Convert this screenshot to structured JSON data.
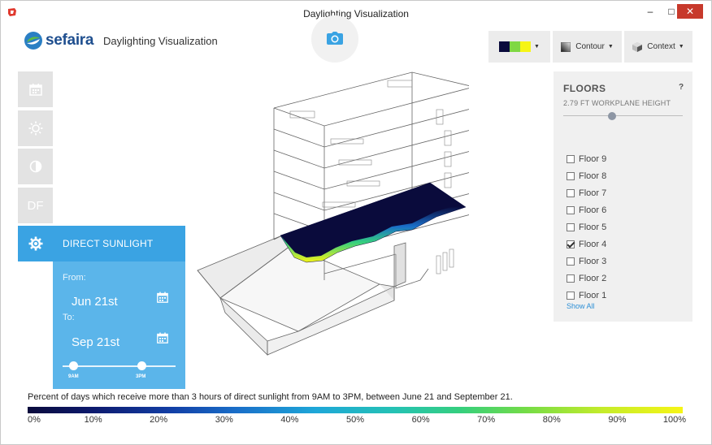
{
  "window": {
    "title": "Daylighting Visualization",
    "minimize": "‒",
    "maximize": "□",
    "close": "✕"
  },
  "header": {
    "brand": "sefaira",
    "title": "Daylighting Visualization"
  },
  "toolbar": {
    "colors": [
      "#0a0b3c",
      "#7fd843",
      "#f6f516"
    ],
    "contour_label": "Contour",
    "context_label": "Context"
  },
  "sidebar": {
    "items": [
      {
        "name": "calendar-icon"
      },
      {
        "name": "sun-icon"
      },
      {
        "name": "contrast-icon"
      },
      {
        "name": "df",
        "label": "DF"
      },
      {
        "name": "gear-icon",
        "active": true
      }
    ]
  },
  "sunlight_panel": {
    "title": "DIRECT SUNLIGHT",
    "from_label": "From:",
    "from_date": "Jun 21st",
    "to_label": "To:",
    "to_date": "Sep 21st",
    "time_start": "9AM",
    "time_end": "3PM"
  },
  "floors_panel": {
    "title": "FLOORS",
    "help": "?",
    "subtitle": "2.79 FT WORKPLANE HEIGHT",
    "floors": [
      {
        "label": "Floor 9",
        "checked": false
      },
      {
        "label": "Floor 8",
        "checked": false
      },
      {
        "label": "Floor 7",
        "checked": false
      },
      {
        "label": "Floor 6",
        "checked": false
      },
      {
        "label": "Floor 5",
        "checked": false
      },
      {
        "label": "Floor 4",
        "checked": true
      },
      {
        "label": "Floor 3",
        "checked": false
      },
      {
        "label": "Floor 2",
        "checked": false
      },
      {
        "label": "Floor 1",
        "checked": false
      }
    ],
    "show_all": "Show All"
  },
  "legend": {
    "caption": "Percent of days which receive more than 3 hours of direct sunlight from 9AM to 3PM, between June 21 and September 21.",
    "ticks": [
      "0%",
      "10%",
      "20%",
      "30%",
      "40%",
      "50%",
      "60%",
      "70%",
      "80%",
      "90%",
      "100%"
    ]
  }
}
